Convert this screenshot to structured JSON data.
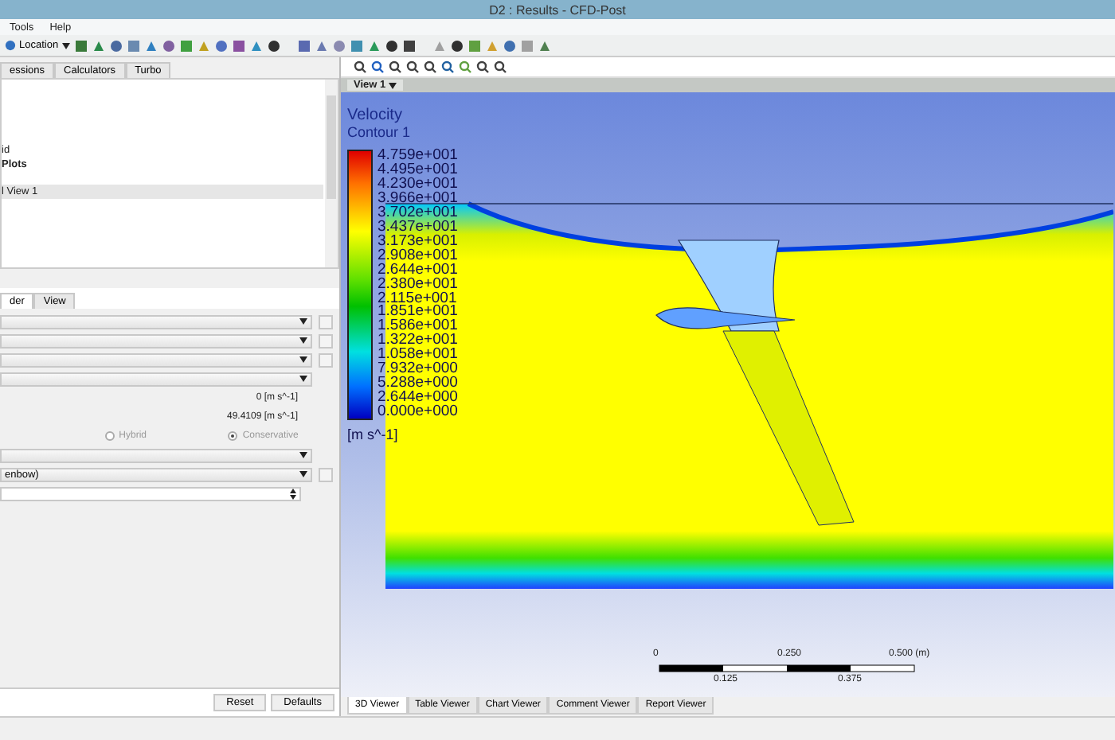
{
  "window": {
    "title": "D2 : Results - CFD-Post"
  },
  "menu": [
    "Tools",
    "Help"
  ],
  "toolbar": {
    "location_label": "Location"
  },
  "left_tabs": [
    {
      "label": "essions",
      "selected": false
    },
    {
      "label": "Calculators",
      "selected": false
    },
    {
      "label": "Turbo",
      "selected": false
    }
  ],
  "tree_items": [
    {
      "label": "id",
      "bold": false,
      "selected": false
    },
    {
      "label": "Plots",
      "bold": true,
      "selected": false
    },
    {
      "label": "l View 1",
      "bold": false,
      "selected": true
    }
  ],
  "details_tabs": [
    {
      "label": "der",
      "selected": true
    },
    {
      "label": "View",
      "selected": false
    }
  ],
  "form_rows": [
    {
      "kind": "dropdown",
      "has_button": true
    },
    {
      "kind": "dropdown",
      "has_button": true
    },
    {
      "kind": "dropdown",
      "has_button": true
    },
    {
      "kind": "dropdown",
      "has_button": false
    },
    {
      "kind": "text",
      "value": "0 [m s^-1]"
    },
    {
      "kind": "text",
      "value": "49.4109 [m s^-1]"
    },
    {
      "kind": "radios",
      "options": [
        {
          "label": "Hybrid",
          "selected": false,
          "disabled": true
        },
        {
          "label": "Conservative",
          "selected": true,
          "disabled": true
        }
      ]
    },
    {
      "kind": "dropdown",
      "has_button": false
    },
    {
      "kind": "dropdown",
      "value": "enbow)",
      "has_button": true
    },
    {
      "kind": "spinner"
    }
  ],
  "buttons": [
    "Reset",
    "Defaults"
  ],
  "view_tab": "View 1",
  "legend": {
    "title": "Velocity",
    "subtitle": "Contour 1",
    "labels": [
      "4.759e+001",
      "4.495e+001",
      "4.230e+001",
      "3.966e+001",
      "3.702e+001",
      "3.437e+001",
      "3.173e+001",
      "2.908e+001",
      "2.644e+001",
      "2.380e+001",
      "2.115e+001",
      "1.851e+001",
      "1.586e+001",
      "1.322e+001",
      "1.058e+001",
      "7.932e+000",
      "5.288e+000",
      "2.644e+000",
      "0.000e+000"
    ],
    "unit": "[m s^-1]"
  },
  "scale_bar": {
    "top_labels": [
      "0",
      "0.250",
      "0.500 (m)"
    ],
    "bottom_labels": [
      "0.125",
      "0.375"
    ]
  },
  "viewer_tabs": [
    {
      "label": "3D Viewer",
      "selected": true
    },
    {
      "label": "Table Viewer",
      "selected": false
    },
    {
      "label": "Chart Viewer",
      "selected": false
    },
    {
      "label": "Comment Viewer",
      "selected": false
    },
    {
      "label": "Report Viewer",
      "selected": false
    }
  ]
}
